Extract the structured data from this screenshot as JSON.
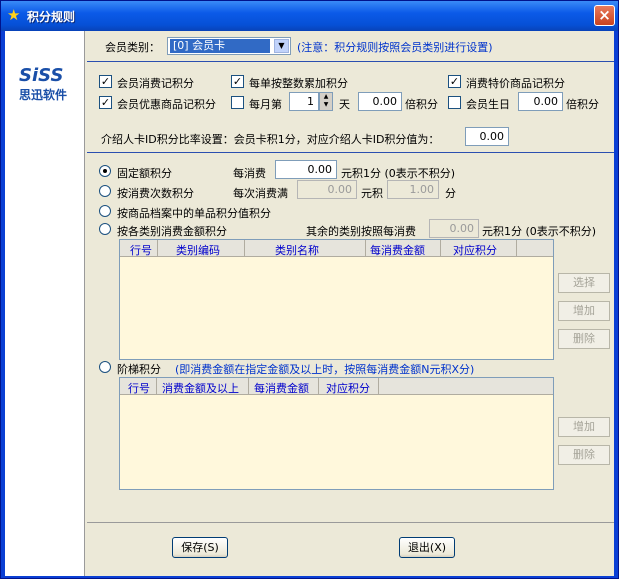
{
  "window": {
    "title": "积分规则",
    "close": "×"
  },
  "logo": {
    "brand": "SiSS",
    "company": "思迅软件"
  },
  "member_type": {
    "label": "会员类别：",
    "value": "[0] 会员卡",
    "note": "(注意：积分规则按照会员类别进行设置)"
  },
  "options": {
    "consume": {
      "label": "会员消费记积分",
      "checked": true
    },
    "per_order": {
      "label": "每单按整数累加积分",
      "checked": true
    },
    "special": {
      "label": "消费特价商品记积分",
      "checked": true
    },
    "discount": {
      "label": "会员优惠商品记积分",
      "checked": true
    },
    "monthly": {
      "label": "每月第",
      "checked": false,
      "day": "1",
      "day_unit": "天",
      "times": "0.00",
      "times_unit": "倍积分"
    },
    "birthday": {
      "label": "会员生日",
      "checked": false,
      "times": "0.00",
      "times_unit": "倍积分"
    }
  },
  "referral": {
    "label": "介绍人卡ID积分比率设置：会员卡积1分，对应介绍人卡ID积分值为：",
    "value": "0.00"
  },
  "rules": {
    "fixed": {
      "label": "固定额积分",
      "selected": true,
      "per_label": "每消费",
      "value": "0.00",
      "unit": "元积1分 (0表示不积分)"
    },
    "count": {
      "label": "按消费次数积分",
      "selected": false,
      "per_label": "每次消费满",
      "value": "0.00",
      "unit": "元积",
      "points": "1.00",
      "points_unit": "分"
    },
    "item": {
      "label": "按商品档案中的单品积分值积分",
      "selected": false
    },
    "category": {
      "label": "按各类别消费金额积分",
      "selected": false,
      "other_label": "其余的类别按照每消费",
      "other_value": "0.00",
      "other_unit": "元积1分 (0表示不积分)"
    },
    "ladder": {
      "label": "阶梯积分",
      "selected": false,
      "note": "(即消费金额在指定金额及以上时，按照每消费金额N元积X分)"
    }
  },
  "category_grid": {
    "columns": [
      "行号",
      "类别编码",
      "类别名称",
      "每消费金额",
      "对应积分"
    ]
  },
  "ladder_grid": {
    "columns": [
      "行号",
      "消费金额及以上",
      "每消费金额",
      "对应积分"
    ]
  },
  "side_buttons": {
    "select": "选择",
    "add": "增加",
    "delete": "删除"
  },
  "buttons": {
    "save": "保存(S)",
    "exit": "退出(X)"
  }
}
